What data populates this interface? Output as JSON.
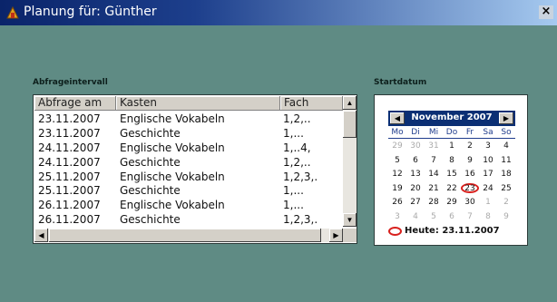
{
  "window": {
    "title": "Planung für: Günther",
    "close_glyph": "×"
  },
  "sections": {
    "interval_label": "Abfrageintervall",
    "start_label": "Startdatum"
  },
  "table": {
    "columns": [
      "Abfrage am",
      "Kasten",
      "Fach"
    ],
    "rows": [
      [
        "23.11.2007",
        "Englische Vokabeln",
        "1,2,.."
      ],
      [
        "23.11.2007",
        "Geschichte",
        "1,..."
      ],
      [
        "24.11.2007",
        "Englische Vokabeln",
        "1,..4,"
      ],
      [
        "24.11.2007",
        "Geschichte",
        "1,2,.."
      ],
      [
        "25.11.2007",
        "Englische Vokabeln",
        "1,2,3,."
      ],
      [
        "25.11.2007",
        "Geschichte",
        "1,..."
      ],
      [
        "26.11.2007",
        "Englische Vokabeln",
        "1,..."
      ],
      [
        "26.11.2007",
        "Geschichte",
        "1,2,3,."
      ]
    ]
  },
  "calendar": {
    "month_label": "November 2007",
    "weekdays": [
      "Mo",
      "Di",
      "Mi",
      "Do",
      "Fr",
      "Sa",
      "So"
    ],
    "weeks": [
      [
        [
          "29",
          0
        ],
        [
          "30",
          0
        ],
        [
          "31",
          0
        ],
        [
          "1",
          1
        ],
        [
          "2",
          1
        ],
        [
          "3",
          1
        ],
        [
          "4",
          1
        ]
      ],
      [
        [
          "5",
          1
        ],
        [
          "6",
          1
        ],
        [
          "7",
          1
        ],
        [
          "8",
          1
        ],
        [
          "9",
          1
        ],
        [
          "10",
          1
        ],
        [
          "11",
          1
        ]
      ],
      [
        [
          "12",
          1
        ],
        [
          "13",
          1
        ],
        [
          "14",
          1
        ],
        [
          "15",
          1
        ],
        [
          "16",
          1
        ],
        [
          "17",
          1
        ],
        [
          "18",
          1
        ]
      ],
      [
        [
          "19",
          1
        ],
        [
          "20",
          1
        ],
        [
          "21",
          1
        ],
        [
          "22",
          1
        ],
        [
          "23",
          1
        ],
        [
          "24",
          1
        ],
        [
          "25",
          1
        ]
      ],
      [
        [
          "26",
          1
        ],
        [
          "27",
          1
        ],
        [
          "28",
          1
        ],
        [
          "29",
          1
        ],
        [
          "30",
          1
        ],
        [
          "1",
          0
        ],
        [
          "2",
          0
        ]
      ],
      [
        [
          "3",
          0
        ],
        [
          "4",
          0
        ],
        [
          "5",
          0
        ],
        [
          "6",
          0
        ],
        [
          "7",
          0
        ],
        [
          "8",
          0
        ],
        [
          "9",
          0
        ]
      ]
    ],
    "selected_day": "23",
    "today_text": "Heute: 23.11.2007"
  },
  "colors": {
    "background": "#5f8b84",
    "calendar_header": "#0b2f74",
    "today_marker": "#d8201d"
  },
  "icons": {
    "app": "app-icon",
    "left": "arrow-left-icon",
    "right": "arrow-right-icon",
    "up": "arrow-up-icon",
    "down": "arrow-down-icon"
  }
}
